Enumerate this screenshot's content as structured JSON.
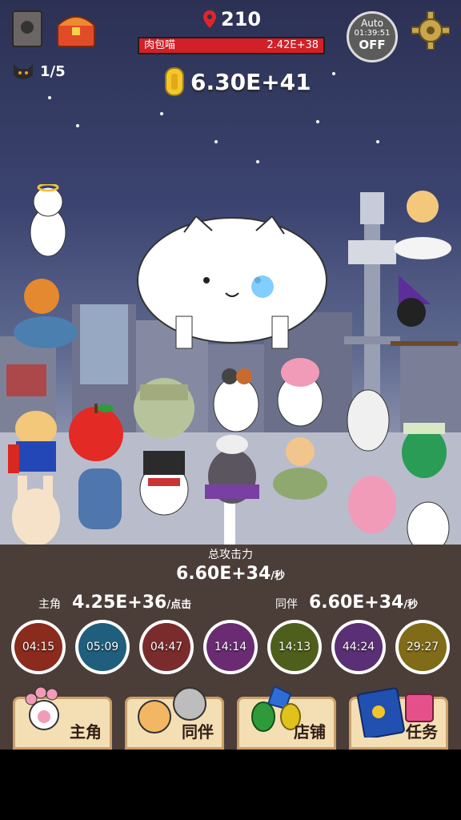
{
  "hud": {
    "stage": "210",
    "boss_name": "肉包喵",
    "boss_hp": "2.42E+38",
    "coins": "6.30E+41",
    "cat_count": "1/5",
    "auto": {
      "label": "Auto",
      "time": "01:39:51",
      "state": "OFF"
    }
  },
  "stats": {
    "total_label": "总攻击力",
    "total_value": "6.60E+34",
    "per_second": "/秒",
    "hero_label": "主角",
    "hero_value": "4.25E+36",
    "per_click": "/点击",
    "companion_label": "同伴",
    "companion_value": "6.60E+34"
  },
  "skills": [
    {
      "time": "04:15",
      "color": "#8a2b1e"
    },
    {
      "time": "05:09",
      "color": "#1f5f7d"
    },
    {
      "time": "04:47",
      "color": "#7a2c2c"
    },
    {
      "time": "14:14",
      "color": "#6a2b73"
    },
    {
      "time": "14:13",
      "color": "#4e5f1c"
    },
    {
      "time": "44:24",
      "color": "#5a2f75"
    },
    {
      "time": "29:27",
      "color": "#7f6b18"
    }
  ],
  "nav": {
    "hero": "主角",
    "companion": "同伴",
    "shop": "店铺",
    "quest": "任务"
  },
  "icons": {
    "book": "book-icon",
    "chest": "treasure-chest-icon",
    "location": "map-pin-icon",
    "coin": "gold-coin-icon",
    "cat": "black-cat-icon",
    "settings": "gear-icon"
  }
}
